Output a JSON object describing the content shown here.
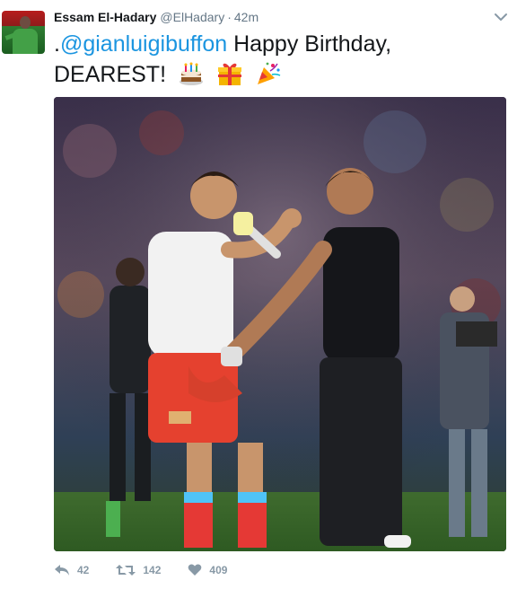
{
  "tweet": {
    "author_name": "Essam El-Hadary",
    "author_handle": "@ElHadary",
    "separator": "·",
    "timestamp": "42m",
    "text_prefix": ".",
    "mention": "@gianluigibuffon",
    "text_body": " Happy Birthday, DEAREST!",
    "emojis": [
      "birthday-cake-icon",
      "wrapped-gift-icon",
      "party-popper-icon"
    ],
    "photo_description_icon": "photo",
    "actions": {
      "reply_count": "42",
      "retweet_count": "142",
      "like_count": "409"
    }
  },
  "colors": {
    "link": "#1b95e0",
    "muted": "#657786",
    "action": "#8899a6",
    "text": "#14171a"
  }
}
